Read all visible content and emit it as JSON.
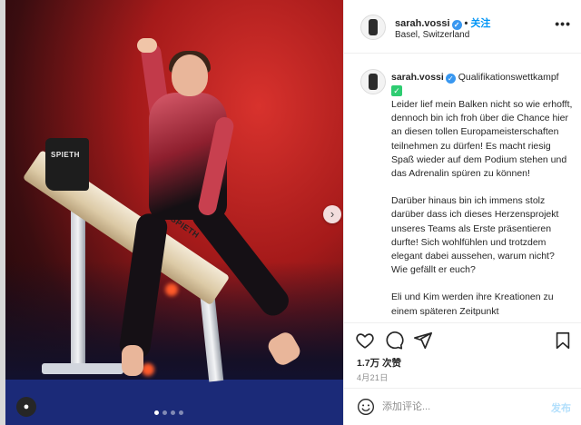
{
  "post": {
    "username": "sarah.vossi",
    "follow_label": "关注",
    "separator": "•",
    "location": "Basel, Switzerland",
    "more_icon": "more-horizontal-icon"
  },
  "photo": {
    "beam_brand": "SPIETH",
    "beam_brand_side": "SPIETH",
    "carousel_dots": 4,
    "active_dot": 0,
    "next_icon": "chevron-right-icon"
  },
  "caption": {
    "username": "sarah.vossi",
    "title": "Qualifikationswettkampf",
    "check_glyph": "✓",
    "paragraph1": "Leider lief mein Balken nicht so wie erhofft, dennoch bin ich froh über die Chance hier an diesen tollen Europameisterschaften teilnehmen zu dürfen! Es macht riesig Spaß wieder auf dem Podium stehen und das Adrenalin spüren zu können!",
    "paragraph2": "Darüber hinaus bin ich immens stolz darüber dass ich dieses Herzensprojekt unseres Teams als Erste präsentieren durfte! Sich wohlfühlen und trotzdem elegant dabei aussehen, warum nicht? Wie gefällt er euch?",
    "paragraph3": "Eli und Kim werden ihre Kreationen zu einem späteren Zeitpunkt"
  },
  "actions": {
    "likes": "1.7万 次赞",
    "date": "4月21日"
  },
  "comment": {
    "placeholder": "添加评论...",
    "post_label": "发布"
  },
  "colors": {
    "accent": "#0095f6",
    "verified": "#3897f0",
    "check": "#2ecc71"
  }
}
